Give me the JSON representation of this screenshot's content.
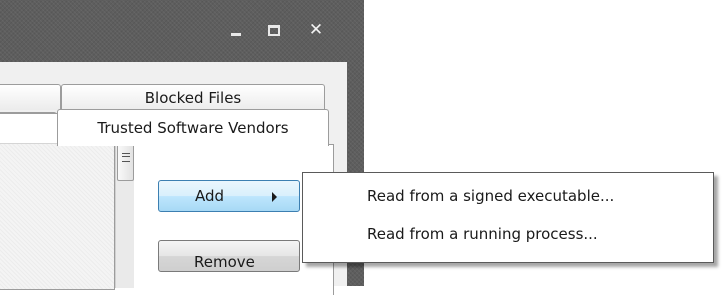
{
  "window": {
    "controls": {
      "minimize_icon": "minimize-icon",
      "maximize_icon": "maximize-icon",
      "close_icon": "close-icon",
      "close_glyph": "✕"
    }
  },
  "tabs": [
    {
      "label": ""
    },
    {
      "label": "Blocked Files"
    },
    {
      "label": ""
    },
    {
      "label": "Trusted Software Vendors",
      "selected": true
    }
  ],
  "list": {
    "scrollbar": {
      "up_icon": "arrow-up-icon",
      "thumb_icon": "grip-icon"
    }
  },
  "buttons": {
    "add_label": "Add",
    "remove_label": "Remove"
  },
  "submenu": {
    "items": [
      {
        "label": "Read from a signed executable..."
      },
      {
        "label": "Read from a running process..."
      }
    ]
  },
  "colors": {
    "titlebar": "#5e5e5e",
    "add_button_hover": "#bee6fd",
    "menu_border": "#5a5a5a"
  }
}
